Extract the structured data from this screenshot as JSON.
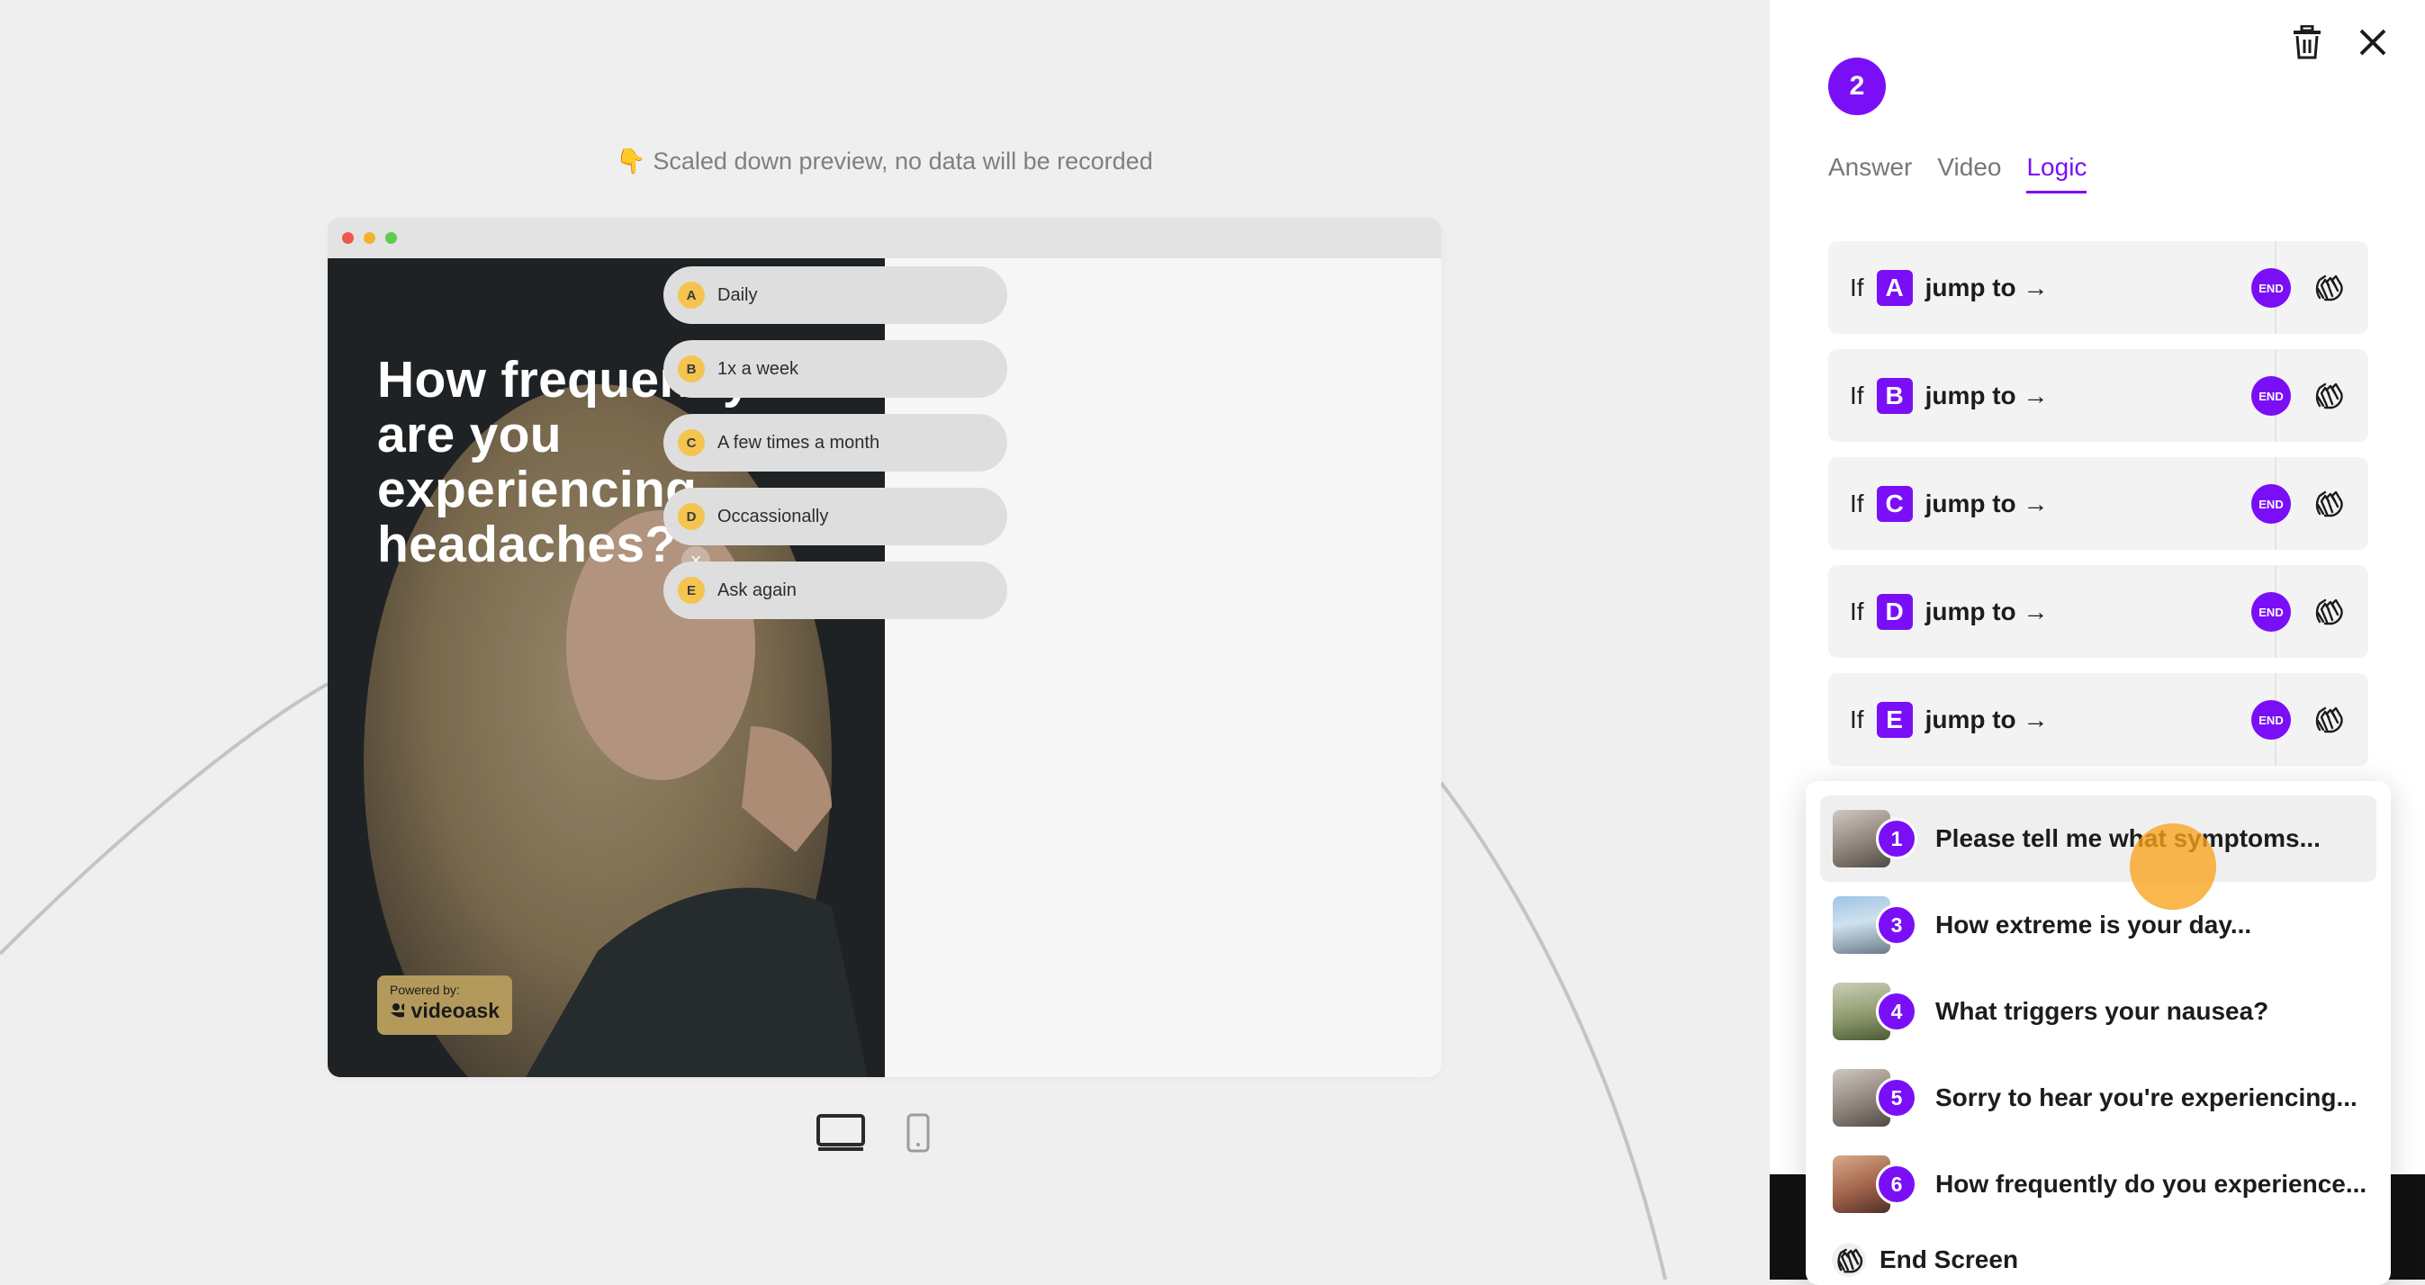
{
  "preview": {
    "notice": "👇 Scaled down preview, no data will be recorded",
    "question": "How frequently are you experiencing headaches?",
    "powered_by": "Powered by:",
    "brand": "videoask",
    "answers": [
      {
        "key": "A",
        "label": "Daily"
      },
      {
        "key": "B",
        "label": "1x a week"
      },
      {
        "key": "C",
        "label": "A few times a month"
      },
      {
        "key": "D",
        "label": "Occassionally"
      },
      {
        "key": "E",
        "label": "Ask again"
      }
    ]
  },
  "panel": {
    "step_number": "2",
    "tabs": [
      {
        "label": "Answer",
        "active": false
      },
      {
        "label": "Video",
        "active": false
      },
      {
        "label": "Logic",
        "active": true
      }
    ],
    "rules": [
      {
        "if": "If",
        "letter": "A",
        "jump": "jump to →",
        "end": "END"
      },
      {
        "if": "If",
        "letter": "B",
        "jump": "jump to →",
        "end": "END"
      },
      {
        "if": "If",
        "letter": "C",
        "jump": "jump to →",
        "end": "END"
      },
      {
        "if": "If",
        "letter": "D",
        "jump": "jump to →",
        "end": "END"
      },
      {
        "if": "If",
        "letter": "E",
        "jump": "jump to →",
        "end": "END"
      }
    ]
  },
  "dropdown": {
    "items": [
      {
        "number": "1",
        "label": "Please tell me what symptoms..."
      },
      {
        "number": "3",
        "label": "How extreme is your day..."
      },
      {
        "number": "4",
        "label": "What triggers your nausea?"
      },
      {
        "number": "5",
        "label": "Sorry to hear you're experiencing..."
      },
      {
        "number": "6",
        "label": "How frequently do you experience..."
      }
    ],
    "end_screen": "End Screen"
  },
  "colors": {
    "accent": "#7a0ff7",
    "answer_key": "#f5c44f",
    "cursor": "#f7a31b"
  }
}
